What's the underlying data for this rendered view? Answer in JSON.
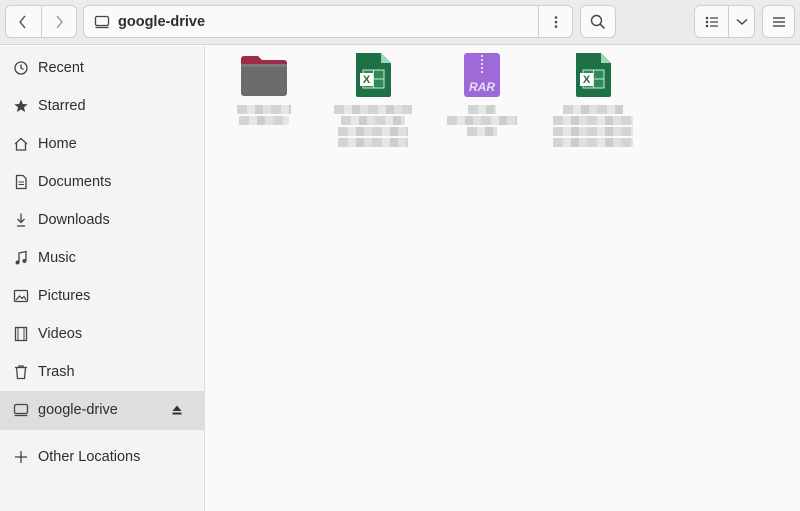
{
  "window": {
    "location_title": "google-drive"
  },
  "sidebar": {
    "items": [
      {
        "label": "Recent",
        "icon": "clock-icon"
      },
      {
        "label": "Starred",
        "icon": "star-icon"
      },
      {
        "label": "Home",
        "icon": "home-icon"
      },
      {
        "label": "Documents",
        "icon": "document-icon"
      },
      {
        "label": "Downloads",
        "icon": "download-icon"
      },
      {
        "label": "Music",
        "icon": "music-icon"
      },
      {
        "label": "Pictures",
        "icon": "picture-icon"
      },
      {
        "label": "Videos",
        "icon": "video-icon"
      },
      {
        "label": "Trash",
        "icon": "trash-icon"
      },
      {
        "label": "google-drive",
        "icon": "drive-icon",
        "selected": true
      },
      {
        "label": "Other Locations",
        "icon": "plus-icon"
      }
    ]
  },
  "files": [
    {
      "type": "folder",
      "icon": "folder-icon",
      "label_obscured": true
    },
    {
      "type": "spreadsheet",
      "icon": "excel-icon",
      "label_obscured": true
    },
    {
      "type": "archive",
      "icon": "rar-archive-icon",
      "icon_text": "RAR",
      "label_obscured": true
    },
    {
      "type": "spreadsheet",
      "icon": "excel-icon",
      "label_obscured": true
    }
  ],
  "colors": {
    "folder": "#6b6b6b",
    "folder_tab": "#9b2c4a",
    "excel": "#1e7145",
    "rar": "#9d6ad8"
  }
}
